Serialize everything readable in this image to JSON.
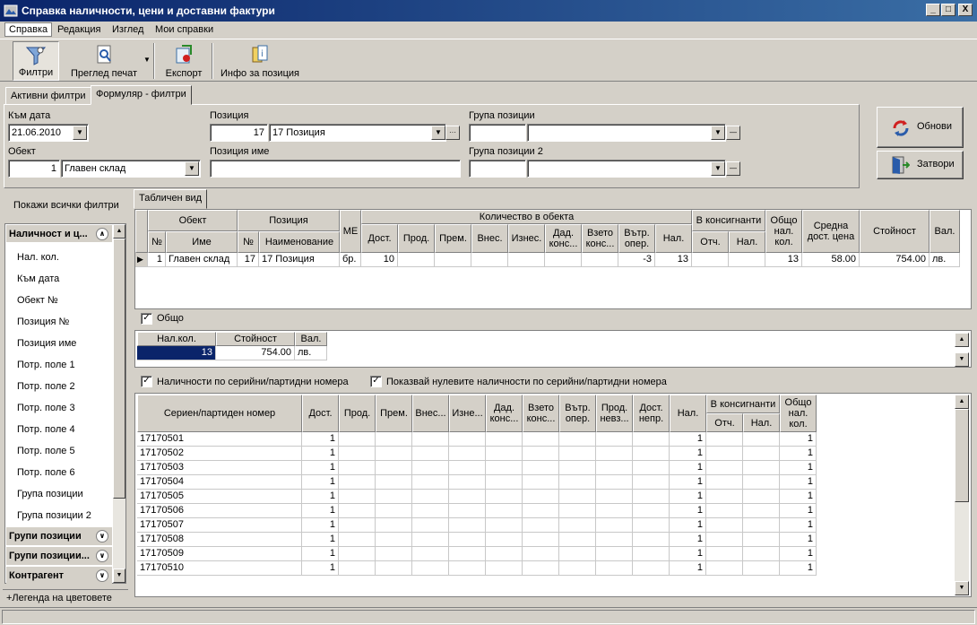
{
  "window": {
    "title": "Справка наличности, цени и доставни фактури",
    "min": "_",
    "max": "□",
    "close": "X"
  },
  "menu": [
    "Справка",
    "Редакция",
    "Изглед",
    "Мои справки"
  ],
  "toolbar": {
    "filters": "Филтри",
    "print_preview": "Преглед печат",
    "export": "Експорт",
    "position_info": "Инфо за позиция"
  },
  "tabs": {
    "active_filters": "Активни филтри",
    "form_filters": "Формуляр - филтри",
    "table_view": "Табличен вид"
  },
  "form": {
    "to_date_label": "Към дата",
    "to_date": "21.06.2010",
    "object_label": "Обект",
    "object_no": "1",
    "object_name": "Главен склад",
    "position_label": "Позиция",
    "position_no": "17",
    "position_name": "17 Позиция",
    "position_name_label": "Позиция име",
    "position_name_value": "",
    "group_label": "Група позиции",
    "group2_label": "Група позиции 2",
    "refresh": "Обнови",
    "close": "Затвори"
  },
  "sidebar": {
    "show_all": "Покажи всички филтри",
    "group1": "Наличност и ц...",
    "items": [
      "Нал. кол.",
      "Към дата",
      "Обект №",
      "Позиция №",
      "Позиция име",
      "Потр. поле 1",
      "Потр. поле 2",
      "Потр. поле 3",
      "Потр. поле 4",
      "Потр. поле 5",
      "Потр. поле 6",
      "Група позиции",
      "Група позиции 2"
    ],
    "groups": [
      "Групи позиции",
      "Групи позиции...",
      "Контрагент"
    ],
    "legend": "+Легенда на цветовете"
  },
  "main_grid": {
    "h_object": "Обект",
    "h_no": "№",
    "h_name": "Име",
    "h_position": "Позиция",
    "h_pos_no": "№",
    "h_pos_name": "Наименование",
    "h_me": "МЕ",
    "h_qty": "Количество в обекта",
    "h_dost": "Дост.",
    "h_prod": "Прод.",
    "h_prem": "Прем.",
    "h_vnes": "Внес.",
    "h_iznes": "Изнес.",
    "h_dad": "Дад. конс...",
    "h_vzeto": "Взето конс...",
    "h_vatr": "Вътр. опер.",
    "h_nal": "Нал.",
    "h_consig": "В консигнанти",
    "h_otch": "Отч.",
    "h_cnal": "Нал.",
    "h_total": "Общо нал. кол.",
    "h_avg": "Средна дост. цена",
    "h_value": "Стойност",
    "h_val": "Вал.",
    "row": {
      "no": "1",
      "name": "Главен склад",
      "pos_no": "17",
      "pos_name": "17 Позиция",
      "me": "бр.",
      "dost": "10",
      "vatr": "-3",
      "nal": "13",
      "total": "13",
      "avg": "58.00",
      "value": "754.00",
      "val": "лв."
    }
  },
  "totals": {
    "label": "Общо",
    "h_qty": "Нал.кол.",
    "h_value": "Стойност",
    "h_val": "Вал.",
    "qty": "13",
    "value": "754.00",
    "val": "лв."
  },
  "serial": {
    "check1": "Наличности по серийни/партидни номера",
    "check2": "Показвай нулевите наличности по серийни/партидни номера",
    "h_serial": "Сериен/партиден номер",
    "h_dost": "Дост.",
    "h_prod": "Прод.",
    "h_prem": "Прем.",
    "h_vnes": "Внес...",
    "h_izne": "Изне...",
    "h_dad": "Дад. конс...",
    "h_vzeto": "Взето конс...",
    "h_vatr": "Вътр. опер.",
    "h_prodn": "Прод. невз...",
    "h_dostn": "Дост. непр.",
    "h_nal": "Нал.",
    "h_consig": "В консигнанти",
    "h_otch": "Отч.",
    "h_cnal": "Нал.",
    "h_total": "Общо нал. кол.",
    "rows": [
      {
        "sn": "17170501",
        "dost": "1",
        "nal": "1",
        "total": "1"
      },
      {
        "sn": "17170502",
        "dost": "1",
        "nal": "1",
        "total": "1"
      },
      {
        "sn": "17170503",
        "dost": "1",
        "nal": "1",
        "total": "1"
      },
      {
        "sn": "17170504",
        "dost": "1",
        "nal": "1",
        "total": "1"
      },
      {
        "sn": "17170505",
        "dost": "1",
        "nal": "1",
        "total": "1"
      },
      {
        "sn": "17170506",
        "dost": "1",
        "nal": "1",
        "total": "1"
      },
      {
        "sn": "17170507",
        "dost": "1",
        "nal": "1",
        "total": "1"
      },
      {
        "sn": "17170508",
        "dost": "1",
        "nal": "1",
        "total": "1"
      },
      {
        "sn": "17170509",
        "dost": "1",
        "nal": "1",
        "total": "1"
      },
      {
        "sn": "17170510",
        "dost": "1",
        "nal": "1",
        "total": "1"
      }
    ]
  }
}
